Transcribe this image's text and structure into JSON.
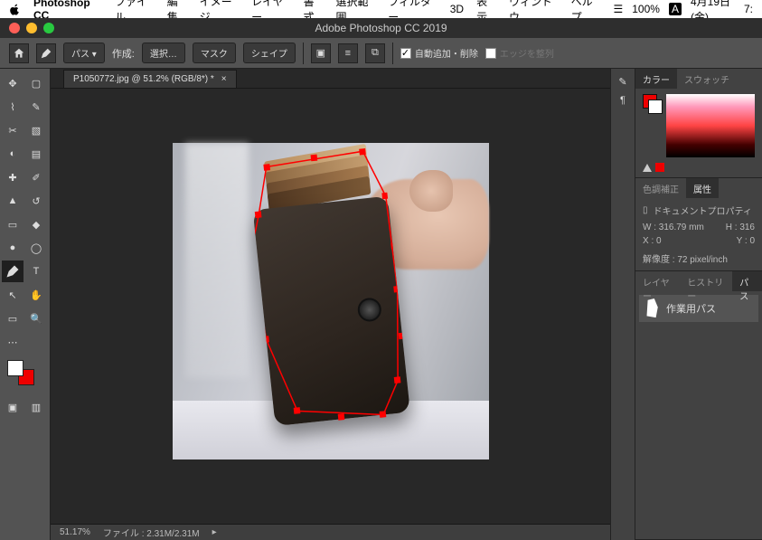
{
  "mac_menu": {
    "app": "Photoshop CC",
    "items": [
      "ファイル",
      "編集",
      "イメージ",
      "レイヤー",
      "書式",
      "選択範囲",
      "フィルター",
      "3D",
      "表示",
      "ウィンドウ",
      "ヘルプ"
    ],
    "battery": "100%",
    "ime": "A",
    "date": "4月19日(金)",
    "time": "7:"
  },
  "ps_title": "Adobe Photoshop CC 2019",
  "options": {
    "path_mode": "パス",
    "make_label": "作成:",
    "selection": "選択…",
    "mask": "マスク",
    "shape": "シェイプ",
    "auto_add_delete": "自動追加・削除",
    "align_edges": "エッジを整列"
  },
  "document": {
    "tab": "P1050772.jpg @ 51.2% (RGB/8*) *",
    "zoom": "51.17%",
    "filesize": "ファイル : 2.31M/2.31M"
  },
  "panels": {
    "color_tab": "カラー",
    "swatch_tab": "スウォッチ",
    "adjust_tab": "色調補正",
    "properties_tab": "属性",
    "properties_title": "ドキュメントプロパティ",
    "w_label": "W :",
    "w_value": "316.79 mm",
    "h_label": "H :",
    "h_value": "316",
    "x_label": "X :",
    "x_value": "0",
    "y_label": "Y :",
    "y_value": "0",
    "resolution": "解像度 : 72 pixel/inch",
    "layers_tab": "レイヤー",
    "history_tab": "ヒストリー",
    "paths_tab": "パス",
    "work_path": "作業用パス"
  },
  "tools": {
    "rows": [
      [
        "move",
        "marquee"
      ],
      [
        "lasso",
        "magic-wand"
      ],
      [
        "crop",
        "slice"
      ],
      [
        "eyedropper",
        "frame"
      ],
      [
        "spot-heal",
        "brush"
      ],
      [
        "stamp",
        "history-brush"
      ],
      [
        "eraser",
        "paint-bucket"
      ],
      [
        "blur",
        "dodge"
      ],
      [
        "pen",
        "type"
      ],
      [
        "path-select",
        "rectangle"
      ],
      [
        "hand",
        "zoom"
      ]
    ],
    "selected": "pen"
  }
}
